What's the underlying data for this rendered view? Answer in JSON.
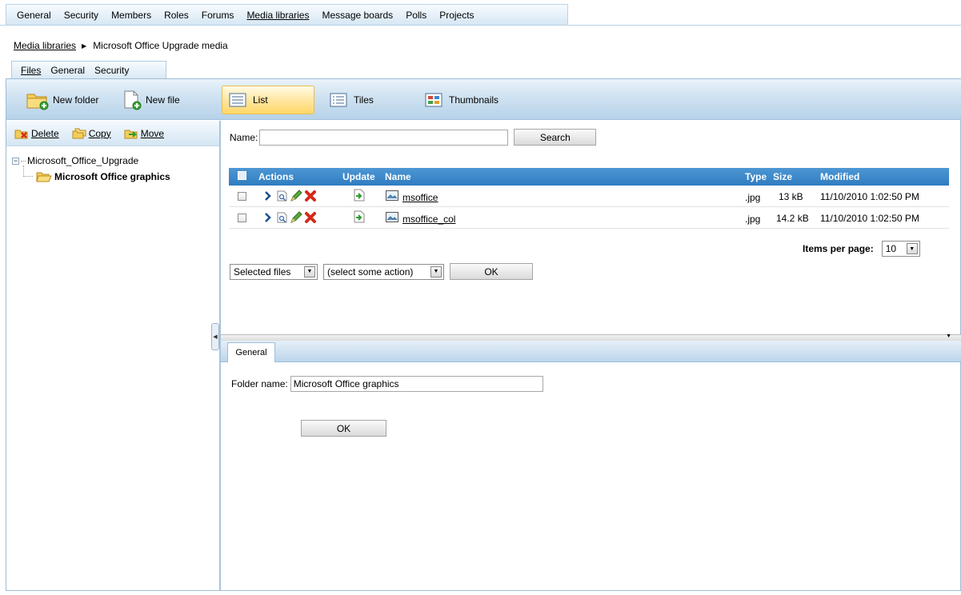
{
  "top_tabs": [
    "General",
    "Security",
    "Members",
    "Roles",
    "Forums",
    "Media libraries",
    "Message boards",
    "Polls",
    "Projects"
  ],
  "top_tabs_active": "Media libraries",
  "breadcrumb": {
    "root": "Media libraries",
    "current": "Microsoft Office Upgrade media"
  },
  "sub_tabs": [
    "Files",
    "General",
    "Security"
  ],
  "sub_tabs_active": "Files",
  "toolbar": {
    "new_folder": "New folder",
    "new_file": "New file",
    "views": {
      "list": "List",
      "tiles": "Tiles",
      "thumbnails": "Thumbnails"
    },
    "active_view": "List"
  },
  "left_actions": {
    "delete": "Delete",
    "copy": "Copy",
    "move": "Move"
  },
  "tree": {
    "root": "Microsoft_Office_Upgrade",
    "child": "Microsoft Office graphics"
  },
  "filter": {
    "label": "Name:",
    "value": "",
    "search_button": "Search"
  },
  "grid": {
    "headers": {
      "actions": "Actions",
      "update": "Update",
      "name": "Name",
      "type": "Type",
      "size": "Size",
      "modified": "Modified"
    },
    "rows": [
      {
        "name": "msoffice",
        "type": ".jpg",
        "size": "13 kB",
        "modified": "11/10/2010 1:02:50 PM"
      },
      {
        "name": "msoffice_col",
        "type": ".jpg",
        "size": "14.2 kB",
        "modified": "11/10/2010 1:02:50 PM"
      }
    ]
  },
  "pager": {
    "label": "Items per page:",
    "value": "10"
  },
  "mass_actions": {
    "scope": "Selected files",
    "action": "(select some action)",
    "ok": "OK"
  },
  "bottom": {
    "tab": "General",
    "folder_label": "Folder name:",
    "folder_value": "Microsoft Office graphics",
    "ok": "OK"
  },
  "colors": {
    "grid_header": "#3a86c8",
    "toolbar": "#cfe2f1",
    "active_view": "#ffe7a3",
    "delete_icon": "#d42a1d"
  }
}
